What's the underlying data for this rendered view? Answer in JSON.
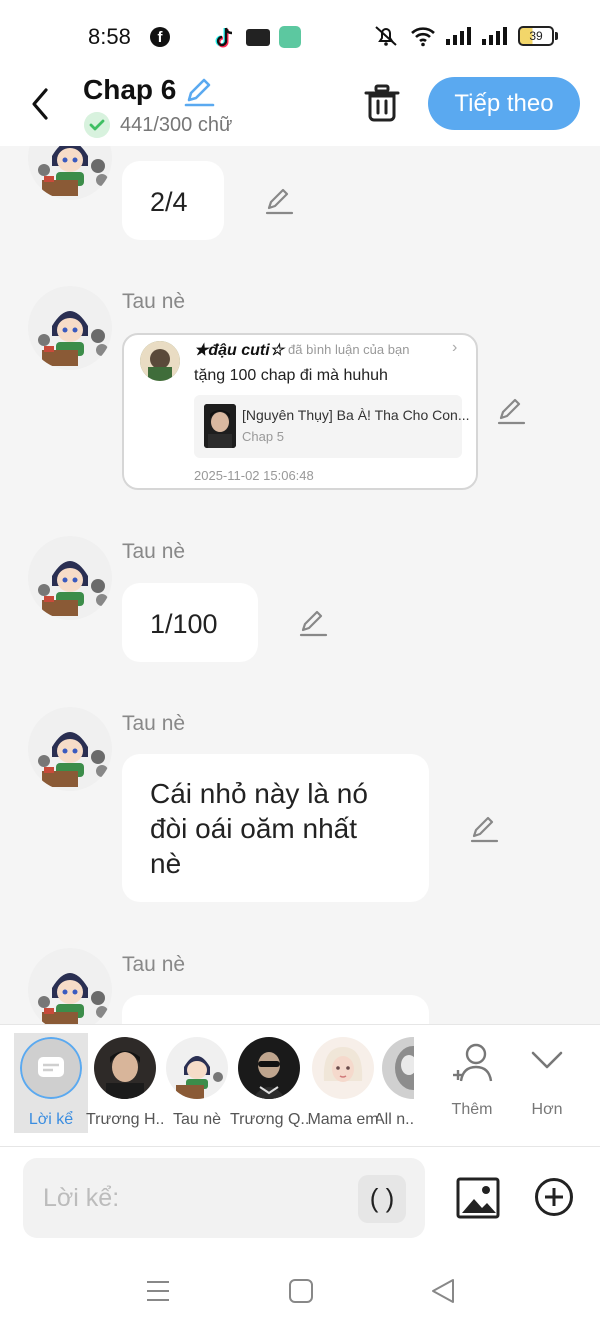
{
  "status_bar": {
    "time": "8:58",
    "battery": "39"
  },
  "header": {
    "title": "Chap 6",
    "word_count": "441/300 chữ",
    "next_label": "Tiếp theo"
  },
  "messages": [
    {
      "type": "text",
      "text": "2/4"
    },
    {
      "type": "comment_card",
      "sender": "Tau nè",
      "commenter": "★đậu cuti☆",
      "action": "đã bình luận của bạn",
      "text": "tặng 100 chap đi mà huhuh",
      "story_title": "[Nguyên Thụy] Ba À! Tha Cho Con...",
      "story_chapter": "Chap 5",
      "time": "2025-11-02 15:06:48"
    },
    {
      "type": "text",
      "sender": "Tau nè",
      "text": "1/100"
    },
    {
      "type": "text",
      "sender": "Tau nè",
      "lines": [
        "Cái nhỏ này là nó",
        "đòi oái oăm nhất",
        "nè"
      ]
    },
    {
      "type": "text",
      "sender": "Tau nè",
      "text": ""
    }
  ],
  "roles": [
    {
      "label": "Lời kể",
      "active": true,
      "icon": "narration-icon"
    },
    {
      "label": "Trương H...",
      "active": false
    },
    {
      "label": "Tau nè",
      "active": false
    },
    {
      "label": "Trương Q...",
      "active": false
    },
    {
      "label": "Mama em",
      "active": false
    },
    {
      "label": "All n...",
      "active": false
    }
  ],
  "role_actions": {
    "add_label": "Thêm",
    "more_label": "Hơn"
  },
  "input": {
    "placeholder": "Lời kể:",
    "paren_label": "( )"
  },
  "colors": {
    "accent": "#5aa9f0",
    "check": "#3fbf63",
    "background": "#f5f5f5"
  }
}
